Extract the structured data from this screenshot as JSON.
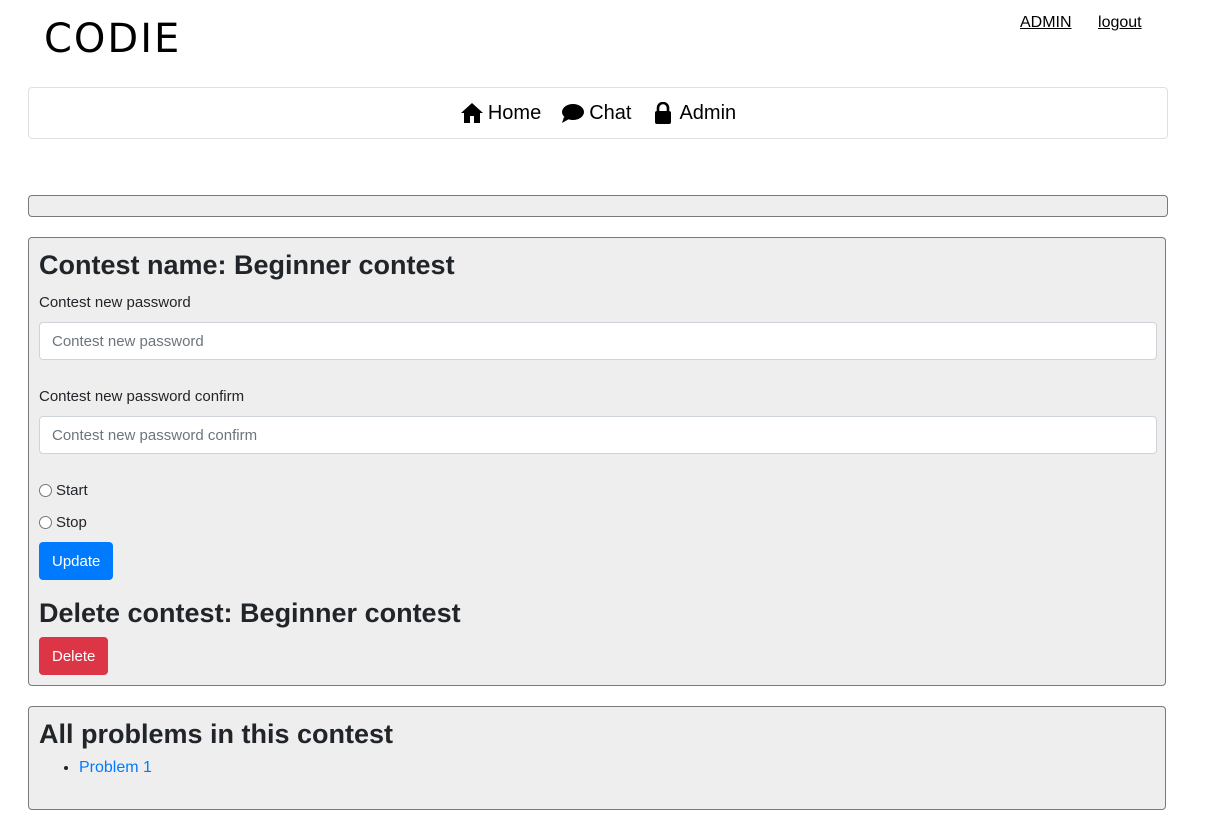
{
  "header": {
    "logo": "CODIE",
    "links": [
      "ADMIN",
      "logout"
    ]
  },
  "nav": {
    "items": [
      {
        "label": "Home",
        "icon": "home-icon"
      },
      {
        "label": "Chat",
        "icon": "chat-icon"
      },
      {
        "label": "Admin",
        "icon": "lock-icon"
      }
    ]
  },
  "contest": {
    "title": "Contest name: Beginner contest",
    "password_label": "Contest new password",
    "password_placeholder": "Contest new password",
    "confirm_label": "Contest new password confirm",
    "confirm_placeholder": "Contest new password confirm",
    "radio_start": "Start",
    "radio_stop": "Stop",
    "update_label": "Update",
    "delete_title": "Delete contest: Beginner contest",
    "delete_label": "Delete"
  },
  "problems": {
    "title": "All problems in this contest",
    "items": [
      "Problem 1"
    ]
  },
  "colors": {
    "primary": "#007bff",
    "danger": "#dc3545",
    "panel_bg": "#eeeeee"
  }
}
